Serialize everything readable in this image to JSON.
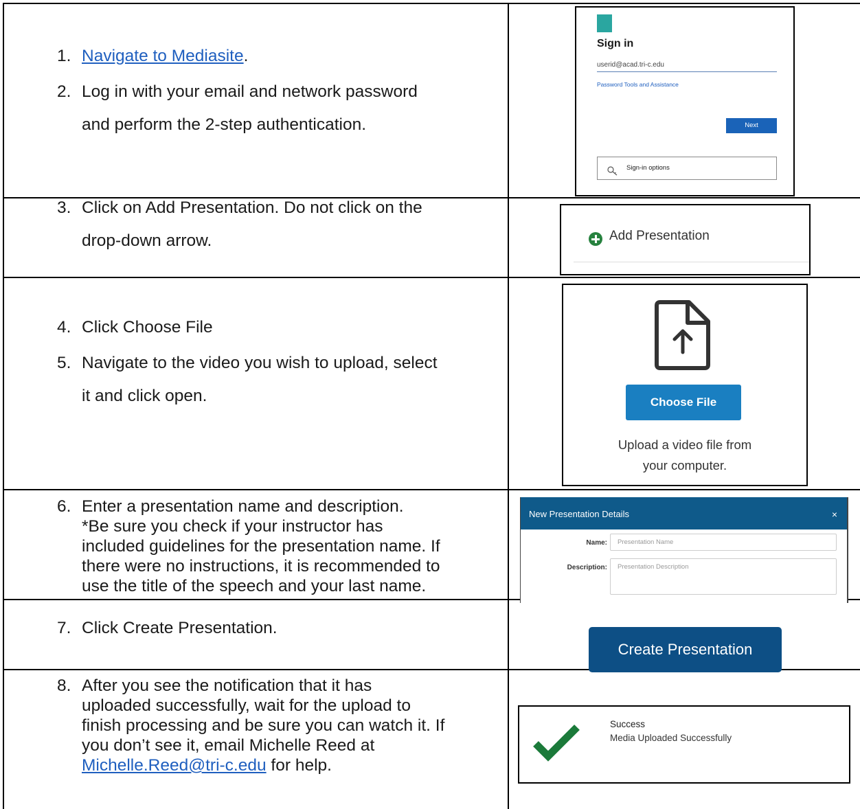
{
  "steps": {
    "s1": {
      "num": "1.",
      "link": "Navigate to Mediasite",
      "after": "."
    },
    "s2": {
      "num": "2.",
      "line1": "Log in with your email and network password",
      "line2": "and perform the 2-step authentication."
    },
    "s3": {
      "num": "3.",
      "line1": "Click on Add Presentation. Do not click on the",
      "line2": "drop-down arrow."
    },
    "s4": {
      "num": "4.",
      "text": "Click Choose File"
    },
    "s5": {
      "num": "5.",
      "line1": "Navigate to the video you wish to upload, select",
      "line2": "it and click open."
    },
    "s6": {
      "num": "6.",
      "line1": "Enter a presentation name and description.",
      "line2": "*Be sure you check if your instructor has",
      "line3": "included guidelines for the presentation name. If",
      "line4": "there were no instructions, it is recommended to",
      "line5": "use the title of the speech and your last name."
    },
    "s7": {
      "num": "7.",
      "text": "Click Create Presentation."
    },
    "s8": {
      "num": "8.",
      "line1": "After you see the notification that it has",
      "line2": "uploaded successfully, wait for the upload to",
      "line3": "finish processing and be sure you can watch it. If",
      "line4": "you don’t see it, email Michelle Reed at",
      "email": "Michelle.Reed@tri-c.edu",
      "after": " for help."
    }
  },
  "signin": {
    "title": "Sign in",
    "input_value": "userid@acad.tri-c.edu",
    "help_link": "Password Tools and Assistance",
    "next": "Next",
    "options": "Sign-in options"
  },
  "add_presentation": {
    "label": "Add Presentation"
  },
  "choose_file": {
    "button": "Choose File",
    "note_line1": "Upload a video file from",
    "note_line2": "your computer."
  },
  "details": {
    "title": "New Presentation Details",
    "close": "×",
    "name_label": "Name:",
    "name_placeholder": "Presentation Name",
    "desc_label": "Description:",
    "desc_placeholder": "Presentation Description"
  },
  "create_presentation": {
    "button": "Create Presentation"
  },
  "success": {
    "title": "Success",
    "message": "Media Uploaded Successfully"
  },
  "colors": {
    "link": "#1f5fbf",
    "check": "#1b7a3a",
    "dialog_header": "#0f5a8a",
    "primary_button": "#1a7fc1"
  }
}
